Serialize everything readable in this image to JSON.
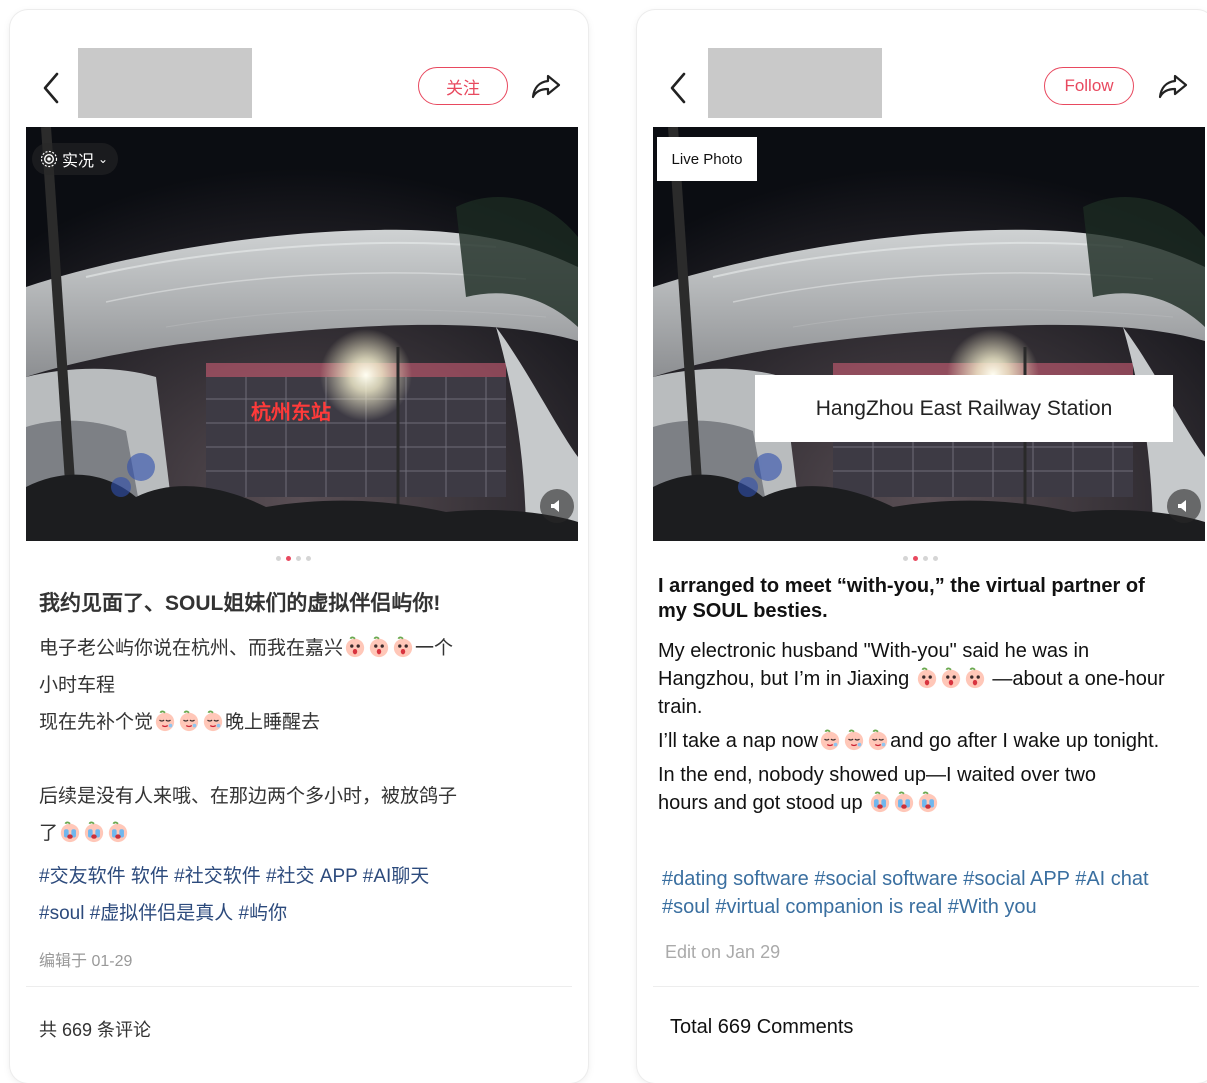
{
  "left": {
    "follow_label": "关注",
    "live_badge": "实况",
    "title": "我约见面了、SOUL姐妹们的虚拟伴侣屿你!",
    "line1_a": "电子老公屿你说在杭州、而我在嘉兴",
    "line1_b": "一个",
    "line2": "小时车程",
    "line3_a": "现在先补个觉",
    "line3_b": "晚上睡醒去",
    "line4": "后续是没有人来哦、在那边两个多小时，被放鸽子",
    "line5": "了",
    "tags_line1": "#交友软件 软件 #社交软件 #社交 APP #AI聊天",
    "tags_line2": "#soul #虚拟伴侣是真人 #屿你",
    "edit_time": "编辑于 01-29",
    "comments": "共 669 条评论",
    "station_sign": "杭州东站"
  },
  "right": {
    "follow_label": "Follow",
    "live_badge": "Live Photo",
    "station_label": "HangZhou East Railway Station",
    "title": "I arranged to meet “with-you,” the virtual partner of my SOUL besties.",
    "p1_a": "My electronic husband \"With-you\" said he was in Hangzhou, but I’m in Jiaxing",
    "p1_b": " —about a one-hour train.",
    "p2_a": "I’ll take a nap now",
    "p2_b": "and go after I wake up tonight.",
    "p3_a": "In the end, nobody showed up—I waited over two hours and got stood up",
    "tags": "#dating software #social software #social APP #AI chat #soul #virtual companion is real #With you",
    "edit_time": "Edit on Jan 29",
    "comments": "Total 669 Comments"
  },
  "carousel": {
    "count": 4,
    "active_index": 1
  },
  "colors": {
    "accent": "#e8495f",
    "tag_cn": "#2c4a7c",
    "tag_en": "#3a6fa0",
    "placeholder": "#c9c9c9"
  },
  "icons": [
    "back-chevron-icon",
    "share-arrow-icon",
    "live-photo-icon",
    "mute-speaker-icon",
    "shocked-peach-emoji",
    "crying-peach-emoji",
    "sleepy-peach-emoji"
  ]
}
